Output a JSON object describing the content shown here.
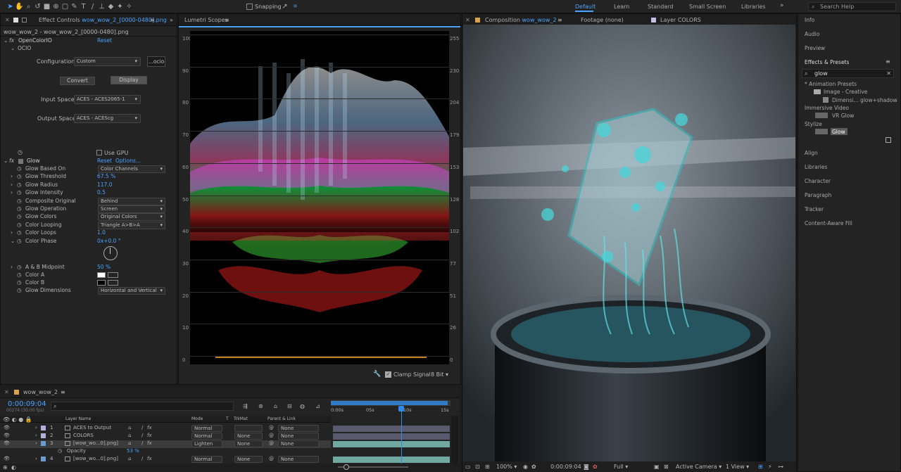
{
  "toolbar": {
    "snapping": "Snapping",
    "workspaces": [
      "Default",
      "Learn",
      "Standard",
      "Small Screen",
      "Libraries"
    ],
    "search_placeholder": "Search Help"
  },
  "effect_controls": {
    "tab_prefix": "Effect Controls",
    "tab_file": "wow_wow_2_[0000-0480].png",
    "breadcrumb": "wow_wow_2 - wow_wow_2_[0000-0480].png",
    "ocio": {
      "name": "OpenColorIO",
      "reset": "Reset",
      "section": "OCIO",
      "config_label": "Configuration:",
      "config_value": "Custom",
      "config_btn": "...ocio",
      "convert": "Convert",
      "display": "Display",
      "input_label": "Input Space:",
      "input_value": "ACES - ACES2065-1",
      "output_label": "Output Space:",
      "output_value": "ACES - ACEScg"
    },
    "use_gpu": "Use GPU",
    "glow": {
      "name": "Glow",
      "reset": "Reset",
      "options": "Options...",
      "params": [
        {
          "label": "Glow Based On",
          "value": "Color Channels",
          "kind": "drop"
        },
        {
          "label": "Glow Threshold",
          "value": "67.5 %",
          "kind": "num"
        },
        {
          "label": "Glow Radius",
          "value": "117.0",
          "kind": "num"
        },
        {
          "label": "Glow Intensity",
          "value": "0.5",
          "kind": "num"
        },
        {
          "label": "Composite Original",
          "value": "Behind",
          "kind": "drop"
        },
        {
          "label": "Glow Operation",
          "value": "Screen",
          "kind": "drop"
        },
        {
          "label": "Glow Colors",
          "value": "Original Colors",
          "kind": "drop"
        },
        {
          "label": "Color Looping",
          "value": "Triangle A>B>A",
          "kind": "drop"
        },
        {
          "label": "Color Loops",
          "value": "1.0",
          "kind": "num"
        },
        {
          "label": "Color Phase",
          "value": "0x+0.0 °",
          "kind": "num"
        }
      ],
      "midpoint_label": "A & B Midpoint",
      "midpoint_value": "50 %",
      "color_a": "Color A",
      "color_b": "Color B",
      "dimensions_label": "Glow Dimensions",
      "dimensions_value": "Horizontal and Vertical"
    }
  },
  "lumetri": {
    "tab": "Lumetri Scopes",
    "left_ticks": [
      "100",
      "90",
      "80",
      "70",
      "60",
      "50",
      "40",
      "30",
      "20",
      "10",
      "0"
    ],
    "right_ticks": [
      "255",
      "230",
      "204",
      "179",
      "153",
      "128",
      "102",
      "77",
      "51",
      "26",
      "0"
    ],
    "clamp": "Clamp Signal",
    "bit": "8 Bit"
  },
  "composition": {
    "tab_prefix": "Composition",
    "tab_name": "wow_wow_2",
    "footage": "Footage (none)",
    "layer": "Layer COLORS",
    "subtab": "wow_wow_2",
    "zoom": "100%",
    "timecode": "0:00:09:04",
    "quality": "Full",
    "camera": "Active Camera",
    "view": "1 View"
  },
  "right_panel": {
    "items": [
      "Info",
      "Audio",
      "Preview"
    ],
    "effects_title": "Effects & Presets",
    "effects_search": "glow",
    "tree": [
      "* Animation Presets",
      "Image - Creative",
      "Dimensi... glow+shadow",
      "Immersive Video",
      "VR Glow",
      "Stylize",
      "Glow"
    ],
    "lower_items": [
      "Align",
      "Libraries",
      "Character",
      "Paragraph",
      "Tracker",
      "Content-Aware Fill"
    ]
  },
  "timeline": {
    "tab": "wow_wow_2",
    "timecode": "0:00:09:04",
    "frames": "00274 (30.00 fps)",
    "search_placeholder": "",
    "headers": [
      "Layer Name",
      "Mode",
      "T",
      "TrkMat",
      "Parent & Link"
    ],
    "ruler": [
      "0:00s",
      "05s",
      "10s",
      "15s"
    ],
    "layers": [
      {
        "num": "1",
        "name": "ACES to Output",
        "mode": "Normal",
        "trkmat": "",
        "parent": "None"
      },
      {
        "num": "2",
        "name": "COLORS",
        "mode": "Normal",
        "trkmat": "None",
        "parent": "None"
      },
      {
        "num": "3",
        "name": "[wow_wo...0].png]",
        "mode": "Lighten",
        "trkmat": "None",
        "parent": "None"
      },
      {
        "num": "4",
        "name": "[wow_wo...0].png]",
        "mode": "Normal",
        "trkmat": "None",
        "parent": "None"
      }
    ],
    "opacity_label": "Opacity",
    "opacity_value": "53 %"
  },
  "colors": {
    "accent": "#4aa3ff",
    "selection": "#2d8ceb",
    "teal": "#2ec4c4"
  }
}
